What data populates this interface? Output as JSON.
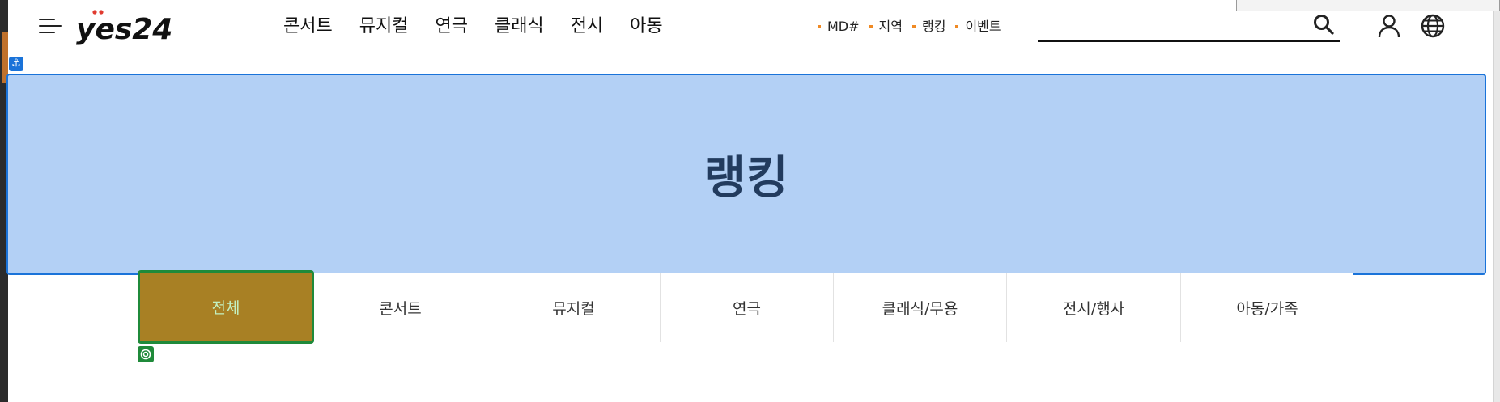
{
  "header": {
    "logo_text": "yes24",
    "gnb": [
      "콘서트",
      "뮤지컬",
      "연극",
      "클래식",
      "전시",
      "아동"
    ],
    "sub_links": [
      "MD#",
      "지역",
      "랭킹",
      "이벤트"
    ],
    "search": {
      "value": "",
      "placeholder": ""
    }
  },
  "hero": {
    "title": "랭킹"
  },
  "tabs": [
    {
      "label": "전체",
      "active": true
    },
    {
      "label": "콘서트",
      "active": false
    },
    {
      "label": "뮤지컬",
      "active": false
    },
    {
      "label": "연극",
      "active": false
    },
    {
      "label": "클래식/무용",
      "active": false
    },
    {
      "label": "전시/행사",
      "active": false
    },
    {
      "label": "아동/가족",
      "active": false
    }
  ],
  "colors": {
    "hero_fill": "#b3d0f5",
    "hero_border": "#1a73d9",
    "active_tab": "#a88024",
    "active_tab_border": "#1f8a3a",
    "bullet": "#f08a24",
    "logo_red": "#e03a2f"
  },
  "icons": [
    "hamburger-menu-icon",
    "search-icon",
    "user-icon",
    "globe-icon",
    "anchor-icon",
    "target-icon"
  ]
}
